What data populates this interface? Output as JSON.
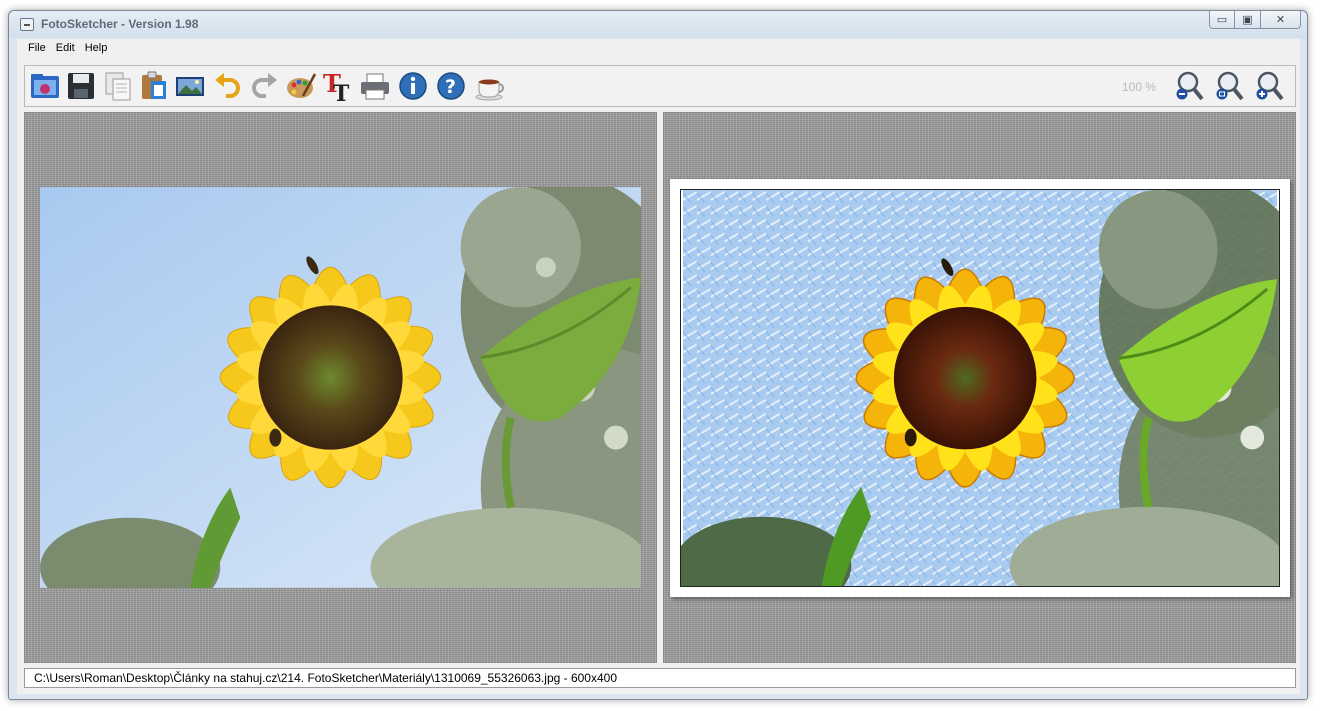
{
  "window": {
    "title": "FotoSketcher - Version 1.98"
  },
  "menu": {
    "items": [
      "File",
      "Edit",
      "Help"
    ]
  },
  "toolbar": {
    "icons": [
      "open-image",
      "save",
      "copy",
      "paste",
      "picture",
      "undo",
      "redo",
      "painting-palette",
      "text",
      "print",
      "info",
      "help",
      "coffee"
    ],
    "zoom_level": "100 %",
    "zoom_icons": [
      "zoom-out",
      "zoom-fit",
      "zoom-in"
    ]
  },
  "status": {
    "path": "C:\\Users\\Roman\\Desktop\\Články na stahuj.cz\\214. FotoSketcher\\Materiály\\1310069_55326063.jpg - 600x400"
  },
  "colors": {
    "accent_blue": "#2f6fb8",
    "panel_gray": "#9e9e9e",
    "sunflower_yellow": "#f5c518",
    "sky_blue": "#b8d5f3"
  }
}
